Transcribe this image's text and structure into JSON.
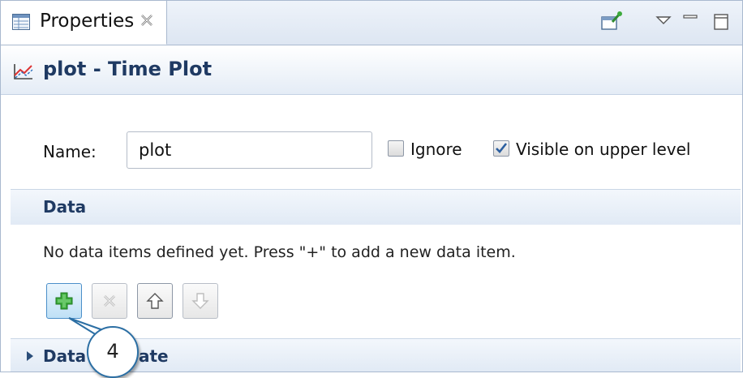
{
  "tab": {
    "title": "Properties"
  },
  "header": {
    "title": "plot - Time Plot"
  },
  "form": {
    "name_label": "Name:",
    "name_value": "plot",
    "ignore_label": "Ignore",
    "ignore_checked": false,
    "visible_label": "Visible on upper level",
    "visible_checked": true
  },
  "data_section": {
    "title": "Data",
    "expanded": true,
    "empty_message": "No data items defined yet. Press \"+\" to add a new data item."
  },
  "next_section": {
    "title_visible": "Data",
    "title_tail": "ate"
  },
  "callout": {
    "number": "4"
  },
  "colors": {
    "accent": "#1f3a63",
    "add_green": "#3caa3c",
    "callout_border": "#2c6fa4"
  },
  "icons": [
    "properties-icon",
    "close-icon",
    "pin-icon",
    "view-menu-icon",
    "minimize-icon",
    "maximize-icon",
    "time-plot-icon",
    "add-icon",
    "remove-icon",
    "move-up-icon",
    "move-down-icon"
  ]
}
